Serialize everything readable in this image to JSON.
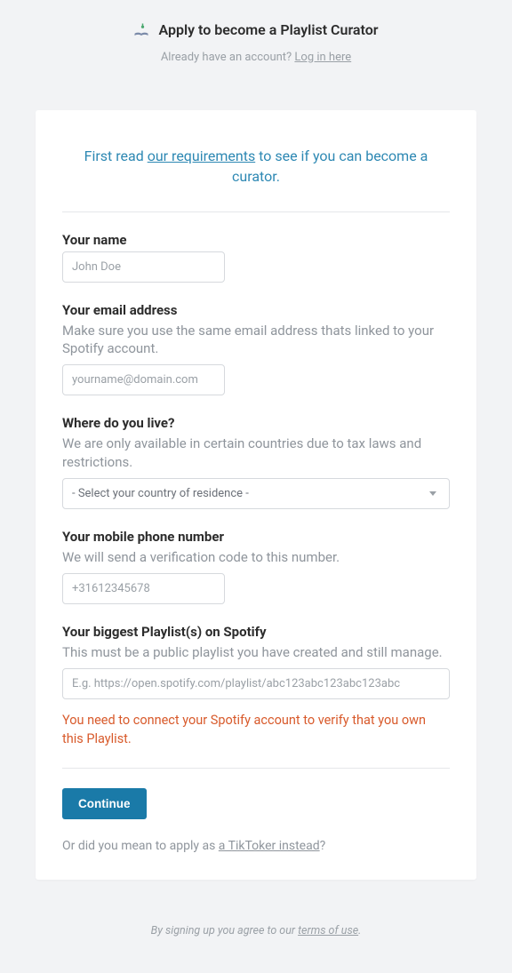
{
  "header": {
    "title": "Apply to become a Playlist Curator",
    "already_text": "Already have an account? ",
    "login_link": "Log in here"
  },
  "intro": {
    "prefix": "First read ",
    "link": "our requirements",
    "suffix": " to see if you can become a curator."
  },
  "fields": {
    "name": {
      "label": "Your name",
      "placeholder": "John Doe"
    },
    "email": {
      "label": "Your email address",
      "hint": "Make sure you use the same email address thats linked to your Spotify account.",
      "placeholder": "yourname@domain.com"
    },
    "country": {
      "label": "Where do you live?",
      "hint": "We are only available in certain countries due to tax laws and restrictions.",
      "placeholder": "- Select your country of residence -"
    },
    "phone": {
      "label": "Your mobile phone number",
      "hint": "We will send a verification code to this number.",
      "placeholder": "+31612345678"
    },
    "playlist": {
      "label": "Your biggest Playlist(s) on Spotify",
      "hint": "This must be a public playlist you have created and still manage.",
      "placeholder": "E.g. https://open.spotify.com/playlist/abc123abc123abc123abc",
      "error": "You need to connect your Spotify account to verify that you own this Playlist."
    }
  },
  "actions": {
    "continue": "Continue",
    "alt_prefix": "Or did you mean to apply as ",
    "alt_link": "a TikToker instead",
    "alt_suffix": "?"
  },
  "footer": {
    "prefix": "By signing up you agree to our ",
    "link": "terms of use",
    "suffix": "."
  }
}
